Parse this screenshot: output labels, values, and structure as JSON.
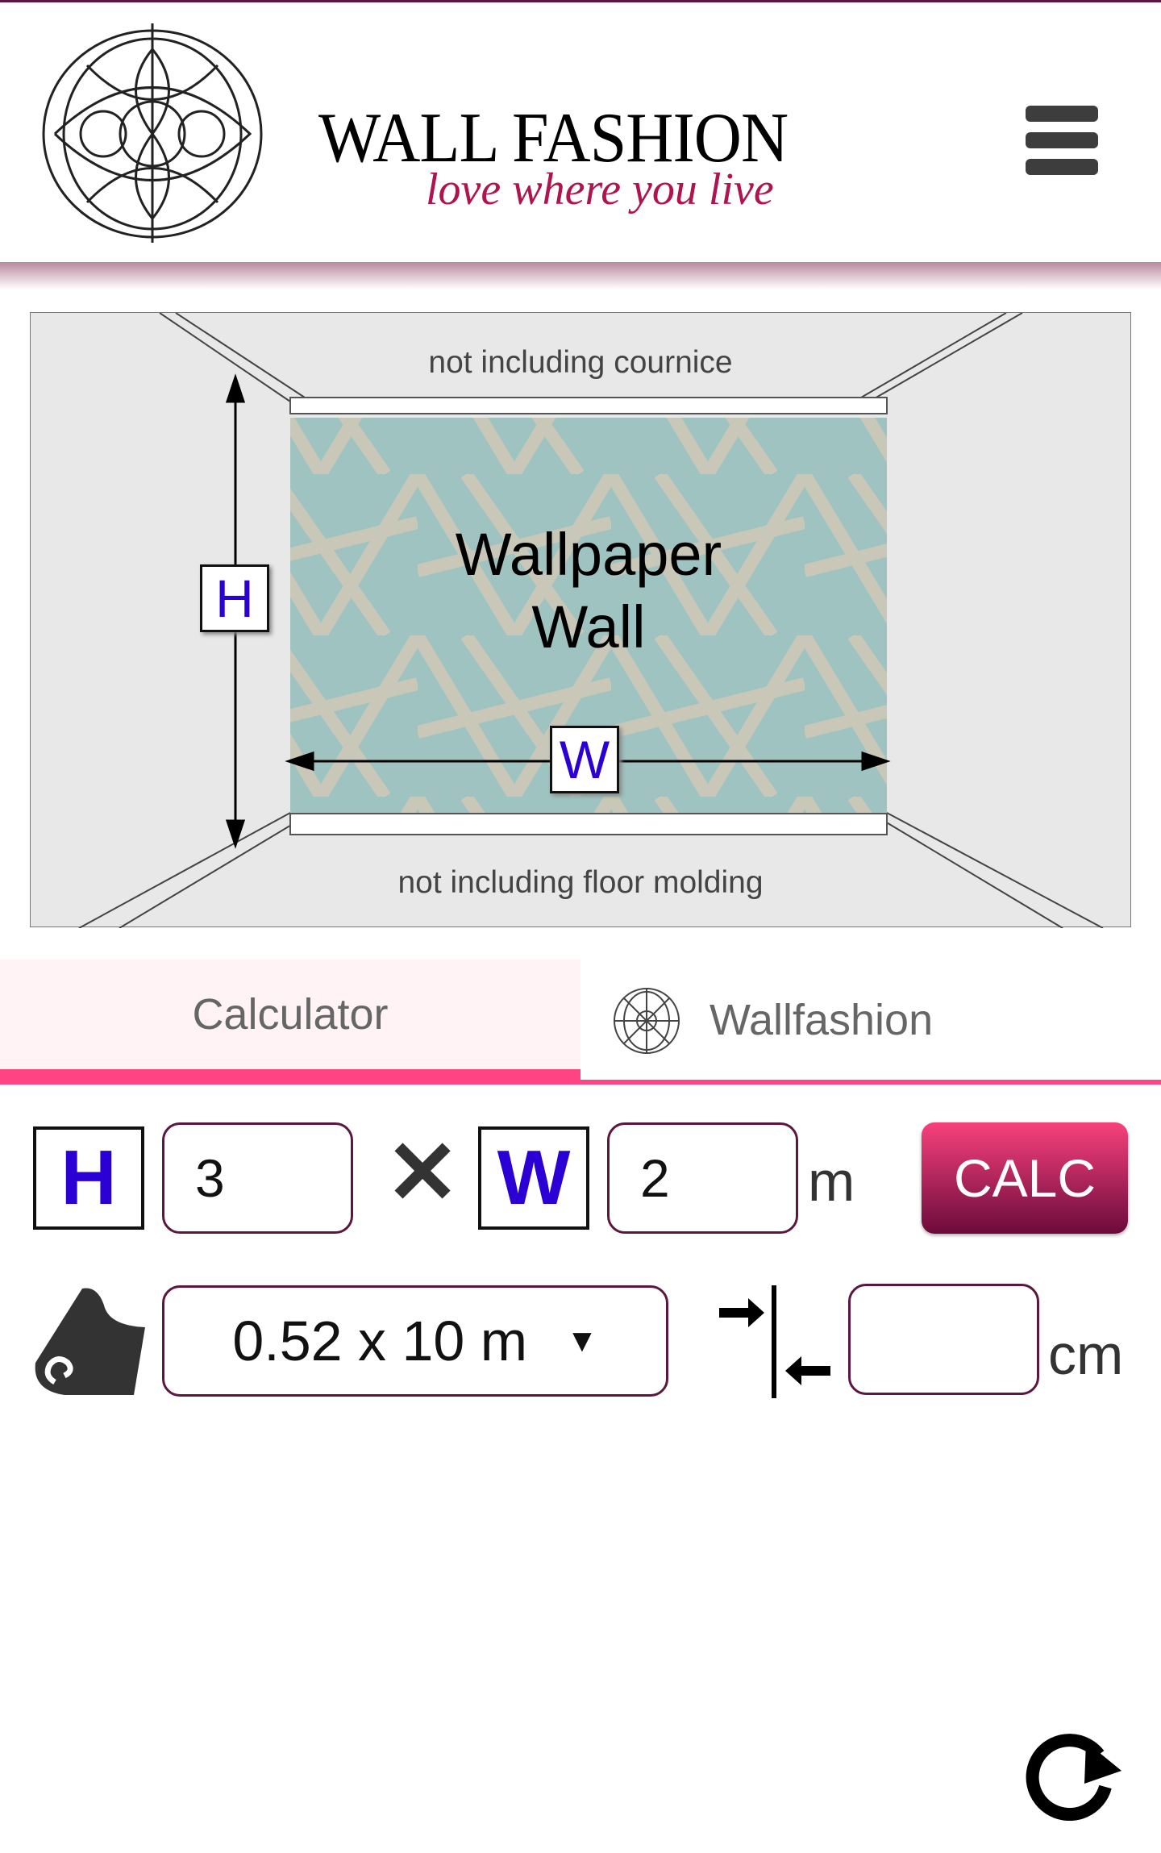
{
  "header": {
    "brand": "WALL FASHION",
    "tagline": "love where you live",
    "logo_icon": "ornament-logo",
    "menu_icon": "hamburger-icon"
  },
  "diagram": {
    "top_note": "not including cournice",
    "bottom_note": "not including floor molding",
    "wall_label_1": "Wallpaper",
    "wall_label_2": "Wall",
    "height_marker": "H",
    "width_marker": "W",
    "wallpaper_colors": {
      "base": "#9ec3c0",
      "lattice": "#cfc8b6"
    }
  },
  "tabs": [
    {
      "label": "Calculator",
      "active": true
    },
    {
      "label": "Wallfashion",
      "active": false
    }
  ],
  "form": {
    "height_label": "H",
    "height_value": "3",
    "times_symbol": "✕",
    "width_label": "W",
    "width_value": "2",
    "unit_m": "m",
    "calc_label": "CALC",
    "roll_select": "0.52 x 10 m",
    "repeat_value": "",
    "unit_cm": "cm"
  },
  "colors": {
    "accent": "#ff4383",
    "button_top": "#f7417c",
    "button_bottom": "#6b0b3b",
    "label_letter": "#2a00d4",
    "input_border": "#5c1740"
  },
  "refresh_icon": "refresh-icon"
}
